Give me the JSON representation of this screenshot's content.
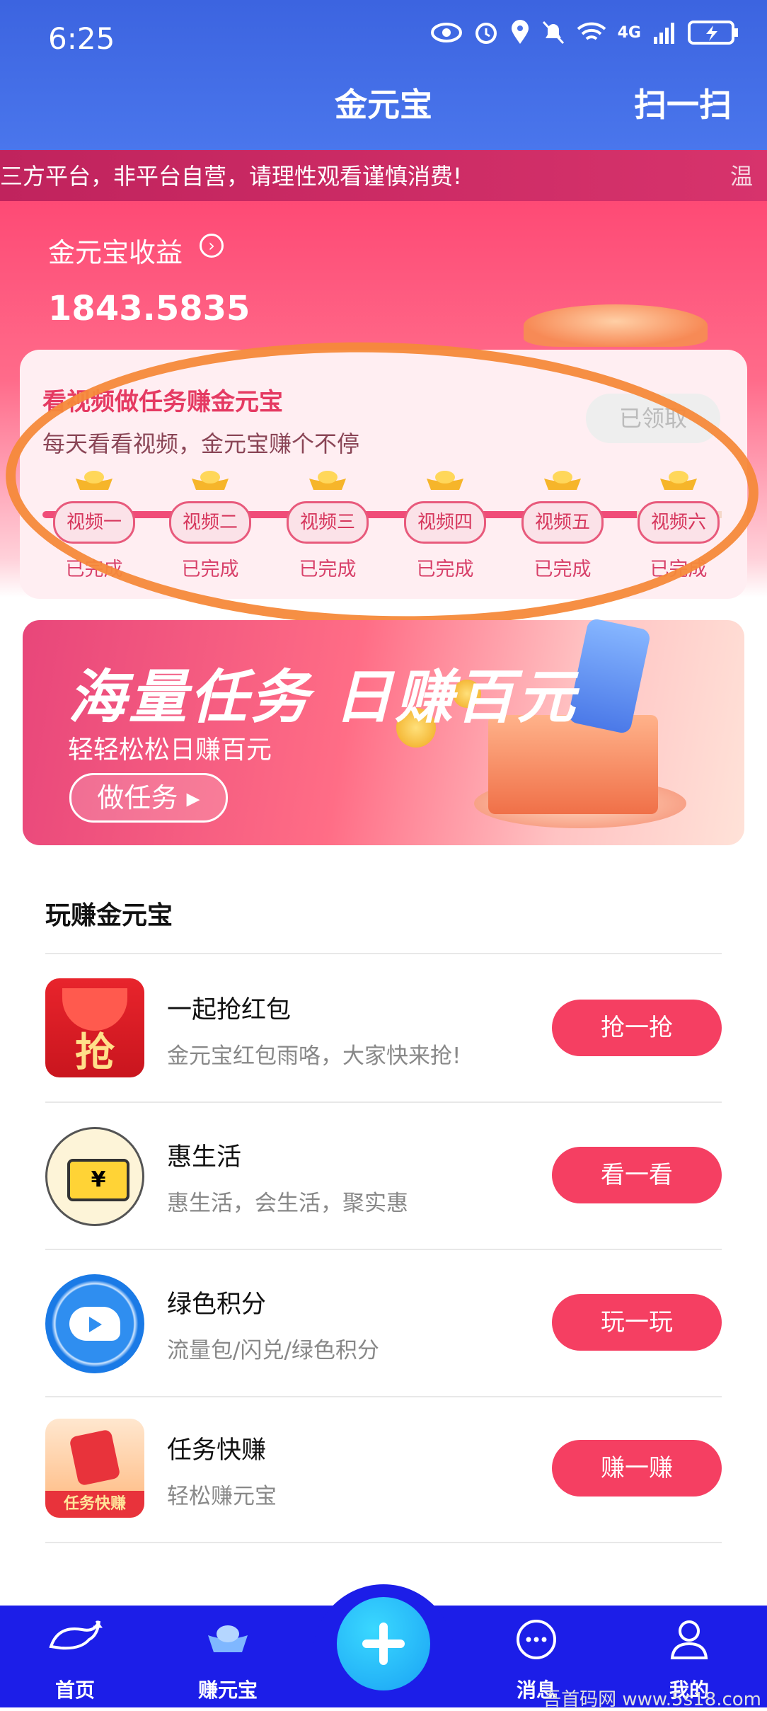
{
  "status_bar": {
    "time": "6:25",
    "network": "4G"
  },
  "header": {
    "title": "金元宝",
    "scan_label": "扫一扫"
  },
  "notice": {
    "text": "三方平台，非平台自营，请理性观看谨慎消费!",
    "tail": "温"
  },
  "earnings": {
    "label": "金元宝收益",
    "value": "1843.5835"
  },
  "video_task": {
    "title": "看视频做任务赚金元宝",
    "subtitle": "每天看看视频，金元宝赚个不停",
    "claimed_label": "已领取",
    "steps": [
      {
        "label": "视频一",
        "status": "已完成"
      },
      {
        "label": "视频二",
        "status": "已完成"
      },
      {
        "label": "视频三",
        "status": "已完成"
      },
      {
        "label": "视频四",
        "status": "已完成"
      },
      {
        "label": "视频五",
        "status": "已完成"
      },
      {
        "label": "视频六",
        "status": "已完成"
      }
    ]
  },
  "banner": {
    "title": "海量任务 日赚百元",
    "subtitle": "轻轻松松日赚百元",
    "button": "做任务 ▸"
  },
  "section": {
    "title": "玩赚金元宝"
  },
  "rows": [
    {
      "title": "一起抢红包",
      "desc": "金元宝红包雨咯，大家快来抢!",
      "button": "抢一抢",
      "icon": "red-envelope-icon"
    },
    {
      "title": "惠生活",
      "desc": "惠生活，会生活，聚实惠",
      "button": "看一看",
      "icon": "coupon-icon"
    },
    {
      "title": "绿色积分",
      "desc": "流量包/闪兑/绿色积分",
      "button": "玩一玩",
      "icon": "whale-icon"
    },
    {
      "title": "任务快赚",
      "desc": "轻松赚元宝",
      "button": "赚一赚",
      "icon": "task-icon"
    }
  ],
  "nav": [
    {
      "label": "首页",
      "icon": "whale-icon"
    },
    {
      "label": "赚元宝",
      "icon": "ingot-icon"
    },
    {
      "label": "",
      "icon": "plus-icon"
    },
    {
      "label": "消息",
      "icon": "message-icon"
    },
    {
      "label": "我的",
      "icon": "profile-icon"
    }
  ],
  "watermark": "吾首码网 www.5s18.com",
  "colors": {
    "header": "#3c64e0",
    "accent": "#f53f62",
    "nav": "#1c1ee8",
    "highlight": "#f6893a"
  }
}
